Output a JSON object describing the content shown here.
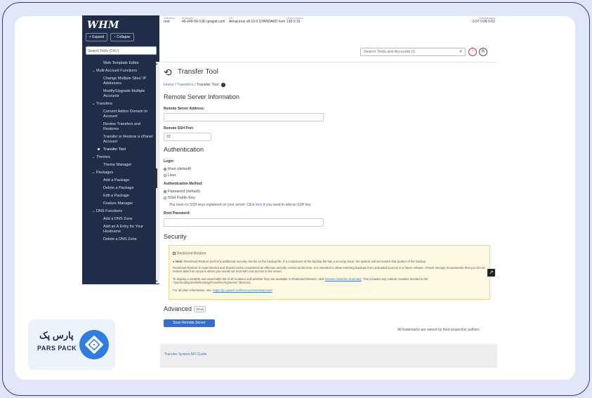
{
  "top": {
    "username_label": "Username",
    "username": "root",
    "hostname_label": "Hostname",
    "hostname": "46-249-99-138.cprapid.com",
    "os_label": "OS",
    "os": "AlmaLinux v8.10.0 STANDARD kvm",
    "cpanel_label": "cPanel Version",
    "cpanel": "130.0.16",
    "load_label": "Load Averages",
    "load": "0.07  0.08  0.02"
  },
  "sidebar": {
    "logo": "WHM",
    "expand": "+ Expand",
    "collapse": "↑ Collapse",
    "search": "Search Tools (Ctrl-/)",
    "items": [
      {
        "label": "Web Template Editor"
      },
      {
        "label": "Multi Account Functions",
        "section": true
      },
      {
        "label": "Change Multiple Sites' IP Addresses"
      },
      {
        "label": "Modify/Upgrade Multiple Accounts"
      },
      {
        "label": "Transfers",
        "section": true
      },
      {
        "label": "Convert Addon Domain to Account"
      },
      {
        "label": "Review Transfers and Restores"
      },
      {
        "label": "Transfer or Restore a cPanel Account"
      },
      {
        "label": "Transfer Tool",
        "active": true
      },
      {
        "label": "Themes",
        "section": true
      },
      {
        "label": "Theme Manager"
      },
      {
        "label": "Packages",
        "section": true
      },
      {
        "label": "Add a Package"
      },
      {
        "label": "Delete a Package"
      },
      {
        "label": "Edit a Package"
      },
      {
        "label": "Feature Manager"
      },
      {
        "label": "DNS Functions",
        "section": true
      },
      {
        "label": "Add a DNS Zone"
      },
      {
        "label": "Add an A Entry for Your Hostname"
      },
      {
        "label": "Delete a DNS Zone"
      }
    ]
  },
  "header": {
    "search_placeholder": "Search Tools and Accounts (/)",
    "alert": "!",
    "user": "R"
  },
  "page": {
    "title": "Transfer Tool",
    "crumb_home": "Home",
    "crumb_transfers": "Transfers",
    "crumb_current": "Transfer Tool",
    "help": "?",
    "remote_heading": "Remote Server Information",
    "address_label": "Remote Server Address:",
    "address_value": "",
    "port_label": "Remote SSH Port:",
    "port_value": "22",
    "auth_heading": "Authentication",
    "login_label": "Login:",
    "login_root": "Root (default)",
    "login_user": "User",
    "method_label": "Authentication Method:",
    "method_password": "Password (default)",
    "method_ssh": "SSH Public Key",
    "ssh_note_pre": "You have no SSH keys registered on your server. Click ",
    "ssh_note_link": "here",
    "ssh_note_post": " if you need to add an SSH key.",
    "root_pw_label": "Root Password:",
    "security_heading": "Security",
    "restricted_label": "Restricted Restore",
    "note_bold": "Note:",
    "note_1": "Restricted Restore performs additional security checks on the backup file. If a component of the backup file has a security issue, the system will not restore that portion of the backup.",
    "note_2": "Restricted Restore is experimental and should not be considered an effective security control at this time. It is intended to allow restoring backups from untrusted sources in a future release. cPanel strongly recommends that you do not restore data from anyone whom you would not trust with root access to the server.",
    "note_3_pre": "To display a sortable and searchable list of all modules and whether they are available in Restricted Restore, click ",
    "note_3_link": "Restore Modules Summary",
    "note_3_post": ". This includes any custom modules located in the \"/usr/local/cpanel/Whostmgr/Transfers/Systems/\" directory.",
    "note_4_pre": "For all other information, see: ",
    "note_4_link": "https://go.cpanel.net/insecurerestoreaccount",
    "advanced_heading": "Advanced",
    "show_btn": "Show",
    "scan_btn": "Scan Remote Server",
    "trademark": "All trademarks are owned by their respective authors.",
    "footer_link": "Transfer System API Guide"
  },
  "brand": {
    "fa_text": "پارس پک",
    "en_text": "PARS PACK"
  },
  "colors": {
    "primary": "#2f6fd3",
    "sidebar_bg": "#1f2d48",
    "warn_bg": "#fff8e1",
    "brand": "#2f7de1"
  }
}
